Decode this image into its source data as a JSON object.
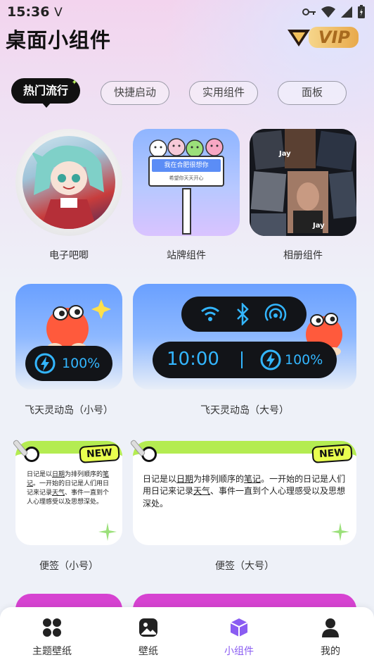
{
  "status_bar": {
    "time": "15:36",
    "carrier_glyph": "V"
  },
  "header": {
    "title": "桌面小组件",
    "vip_label": "VIP"
  },
  "tabs": [
    {
      "label": "热门流行",
      "active": true
    },
    {
      "label": "快捷启动",
      "active": false
    },
    {
      "label": "实用组件",
      "active": false
    },
    {
      "label": "面板",
      "active": false
    }
  ],
  "widgets": {
    "badge": {
      "caption": "电子吧唧"
    },
    "sign": {
      "caption": "站牌组件",
      "line1": "我在合肥很想你",
      "line2": "希望你天天开心"
    },
    "album": {
      "caption": "相册组件"
    },
    "island_small": {
      "caption": "飞天灵动岛（小号）",
      "battery": "100%"
    },
    "island_large": {
      "caption": "飞天灵动岛（大号）",
      "time": "10:00",
      "battery": "100%"
    },
    "note_small": {
      "caption": "便签（小号）",
      "new_label": "NEW",
      "text_a": "日记是以",
      "text_b": "日期",
      "text_c": "为排列顺序的",
      "text_d": "笔记",
      "text_e": "。一开始的日记是人们用日记来记录",
      "text_f": "天气",
      "text_g": "、事件一直到个人心理感受以及思想深处。"
    },
    "note_large": {
      "caption": "便签（大号）",
      "new_label": "NEW",
      "text_a": "日记是以",
      "text_b": "日期",
      "text_c": "为排列顺序的",
      "text_d": "笔记",
      "text_e": "。一开始的日记是人们用日记来记录",
      "text_f": "天气",
      "text_g": "、事件一直到个人心理感受以及思想深处。"
    }
  },
  "bottom_nav": [
    {
      "label": "主题壁纸",
      "icon": "grid-icon",
      "active": false
    },
    {
      "label": "壁纸",
      "icon": "image-icon",
      "active": false
    },
    {
      "label": "小组件",
      "icon": "cube-icon",
      "active": true
    },
    {
      "label": "我的",
      "icon": "person-icon",
      "active": false
    }
  ],
  "colors": {
    "accent": "#8a5cf2",
    "tab_active_bg": "#111111",
    "note_green": "#b4ec51",
    "new_tag": "#e9ff4f",
    "island_blue": "#33b6ff"
  }
}
